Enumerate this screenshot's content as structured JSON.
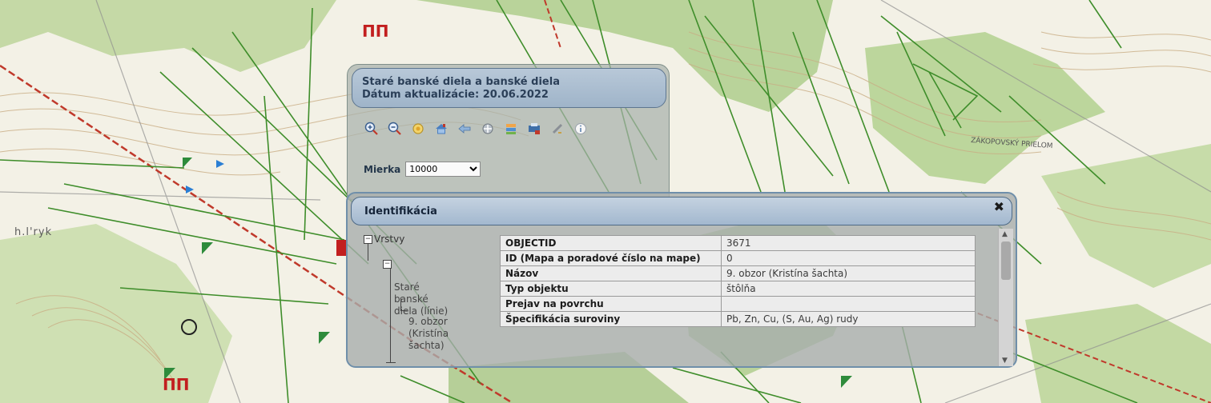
{
  "map": {
    "label_topo": "h.l'ryk",
    "label_valley": "ZÁKOPOVSKÝ PRIELOM"
  },
  "tool_panel": {
    "title_line1": "Staré banské diela a banské diela",
    "title_line2": "Dátum aktualizácie: 20.06.2022",
    "tools": [
      "zoom-in-icon",
      "zoom-out-icon",
      "full-extent-icon",
      "home-icon",
      "back-icon",
      "pan-icon",
      "layers-icon",
      "print-icon",
      "measure-icon",
      "info-icon"
    ],
    "scale_label": "Mierka",
    "scale_value": "10000"
  },
  "identification": {
    "title": "Identifikácia",
    "close": "✖",
    "tree": {
      "root": "Vrstvy",
      "group": "Staré\nbanské\ndiela (línie)",
      "leaf": "9. obzor\n(Kristína\nšachta)"
    },
    "attributes": [
      {
        "key": "OBJECTID",
        "value": "3671"
      },
      {
        "key": "ID (Mapa a poradové číslo na mape)",
        "value": "0"
      },
      {
        "key": "Názov",
        "value": "9. obzor (Kristína šachta)"
      },
      {
        "key": "Typ objektu",
        "value": "štôlňa"
      },
      {
        "key": "Prejav na povrchu",
        "value": ""
      },
      {
        "key": "Špecifikácia suroviny",
        "value": "Pb, Zn, Cu, (S, Au, Ag) rudy"
      }
    ]
  }
}
